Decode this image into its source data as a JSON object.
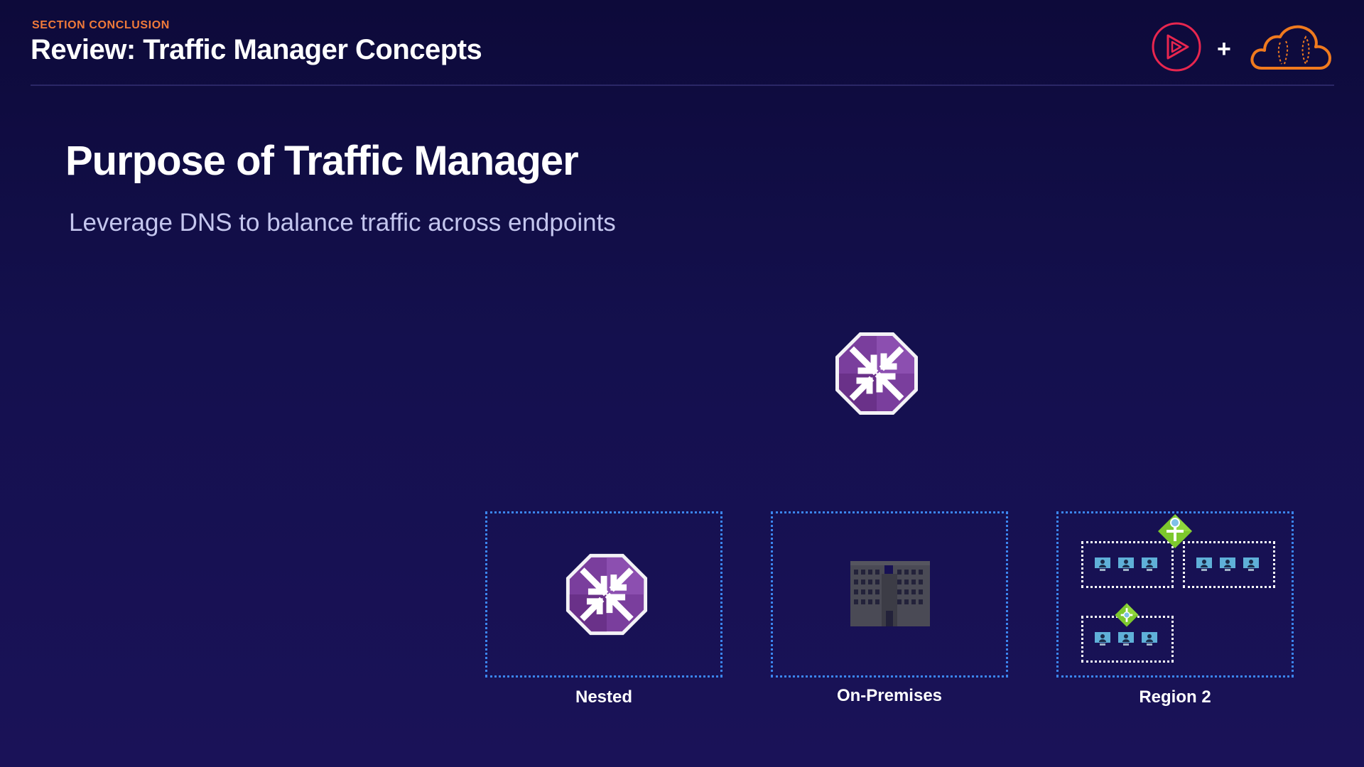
{
  "header": {
    "eyebrow": "SECTION CONCLUSION",
    "title": "Review: Traffic Manager Concepts",
    "logos": {
      "left": "pluralsight-play-icon",
      "separator": "+",
      "right": "cloud-icon"
    }
  },
  "slide": {
    "title": "Purpose of Traffic Manager",
    "subtitle": "Leverage DNS to balance traffic across endpoints"
  },
  "diagram": {
    "top_icon": "traffic-manager-icon",
    "endpoints": [
      {
        "label": "Nested",
        "icon": "traffic-manager-icon"
      },
      {
        "label": "On-Premises",
        "icon": "building-icon"
      },
      {
        "label": "Region 2",
        "icon": "vm-scale-sets-with-load-balancers"
      }
    ]
  },
  "colors": {
    "accent_orange": "#f07a3a",
    "box_border_blue": "#3b86f0",
    "traffic_manager_purple": "#7a3e9d",
    "load_balancer_green": "#7dc82d",
    "background_top": "#0d0a3a",
    "background_bottom": "#1a1258"
  }
}
